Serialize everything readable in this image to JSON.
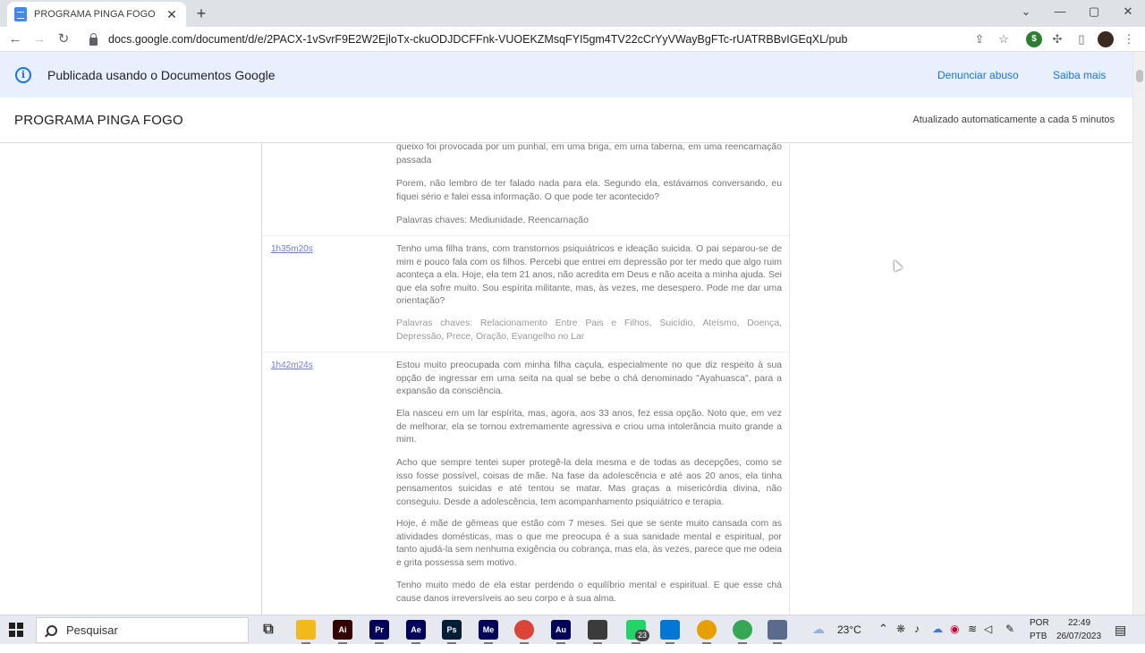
{
  "browser": {
    "tab_title": "PROGRAMA PINGA FOGO",
    "tab_close": "✕",
    "new_tab": "+",
    "url": "docs.google.com/document/d/e/2PACX-1vSvrF9E2W2EjloTx-ckuODJDCFFnk-VUOEKZMsqFYI5gm4TV22cCrYyVWayBgFTc-rUATRBBvIGEqXL/pub",
    "window_controls": [
      "⌄",
      "—",
      "▢",
      "✕"
    ]
  },
  "banner": {
    "text": "Publicada usando o Documentos Google",
    "report_link": "Denunciar abuso",
    "learn_link": "Saiba mais"
  },
  "doc": {
    "title": "PROGRAMA PINGA FOGO",
    "updated": "Atualizado automaticamente a cada 5 minutos"
  },
  "entries": [
    {
      "timestamp": "",
      "paragraphs": [
        "queixo foi provocada por um punhal, em uma briga, em uma taberna, em uma reencarnação passada",
        "Porem, não lembro de ter falado nada para ela. Segundo ela, estávamos conversando, eu fiquei sério e falei essa informação. O que pode ter acontecido?",
        "Palavras chaves: Mediunidade, Reencarnação"
      ]
    },
    {
      "timestamp": "1h35m20s",
      "paragraphs": [
        "Tenho uma filha trans, com transtornos psiquiátricos e ideação suicida. O pai separou-se de mim e pouco fala com os filhos. Percebi que entrei em depressão por ter medo que algo ruim aconteça a ela. Hoje, ela tem 21 anos, não acredita em Deus e não aceita a minha ajuda. Sei que ela sofre muito. Sou espírita militante, mas, às vezes, me desespero. Pode me dar uma orientação?",
        "Palavras chaves: Relacionamento Entre Pais e Filhos, Suicídio, Ateísmo, Doença, Depressão, Prece, Oração, Evangelho no Lar"
      ]
    },
    {
      "timestamp": "1h42m24s",
      "paragraphs": [
        "Estou muito preocupada com minha filha caçula, especialmente no que diz respeito à sua opção de ingressar em uma seita na qual se bebe o chá denominado \"Ayahuasca\", para a expansão da consciência.",
        "Ela nasceu em um lar espírita, mas, agora, aos 33 anos, fez essa opção. Noto que, em vez de melhorar, ela se tornou extremamente agressiva e criou uma intolerância muito grande a mim.",
        "Acho que sempre tentei super protegê-la dela mesma e de todas as decepções, como se isso fosse possível, coisas de mãe. Na fase da adolescência e até aos 20 anos, ela tinha pensamentos suicidas e até tentou se matar. Mas graças a misericórdia divina, não conseguiu. Desde a adolescência, tem acompanhamento psiquiátrico e terapia.",
        "Hoje, é mãe de gêmeas que estão com 7 meses. Sei que se sente muito cansada com as atividades domésticas, mas o que me preocupa é a sua sanidade mental e espiritual, por tanto ajudá-la sem nenhuma exigência ou cobrança, mas ela, às vezes, parece que me odeia e grita possessa sem motivo.",
        "Tenho muito medo de ela estar perdendo o equilíbrio mental e espiritual. E que esse chá cause danos irreversíveis ao seu corpo e à sua alma."
      ]
    }
  ],
  "taskbar": {
    "search_placeholder": "Pesquisar",
    "apps": [
      {
        "name": "task-view",
        "label": "⧉",
        "color": "#e6eaf0"
      },
      {
        "name": "file-explorer",
        "label": "",
        "color": "#f2b91c"
      },
      {
        "name": "illustrator",
        "label": "Ai",
        "color": "#330000"
      },
      {
        "name": "premiere",
        "label": "Pr",
        "color": "#00005b"
      },
      {
        "name": "after-effects",
        "label": "Ae",
        "color": "#00005b"
      },
      {
        "name": "photoshop",
        "label": "Ps",
        "color": "#001e36"
      },
      {
        "name": "media-encoder",
        "label": "Me",
        "color": "#00005b"
      },
      {
        "name": "chrome",
        "label": "",
        "color": "#db4437"
      },
      {
        "name": "audition",
        "label": "Au",
        "color": "#00005b"
      },
      {
        "name": "app-dark",
        "label": "",
        "color": "#3b3b3b"
      },
      {
        "name": "whatsapp",
        "label": "",
        "color": "#25d366"
      },
      {
        "name": "mail",
        "label": "",
        "color": "#0078d4"
      },
      {
        "name": "chrome-2",
        "label": "",
        "color": "#e8a000"
      },
      {
        "name": "chrome-3",
        "label": "",
        "color": "#34a853"
      },
      {
        "name": "settings-app",
        "label": "",
        "color": "#5b6b8c"
      }
    ],
    "whatsapp_badge": "23",
    "weather_temp": "23°C",
    "lang_top": "POR",
    "lang_bottom": "PTB",
    "time": "22:49",
    "date": "26/07/2023"
  }
}
